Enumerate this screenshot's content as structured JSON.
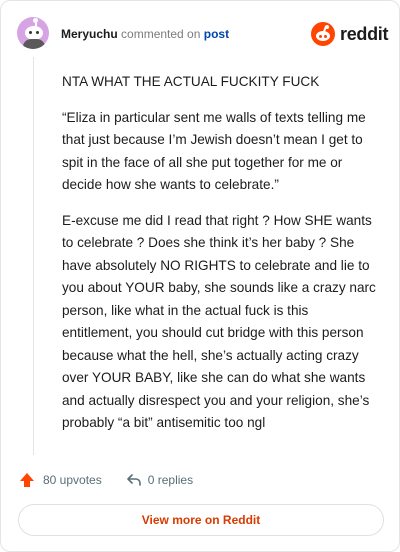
{
  "header": {
    "username": "Meryuchu",
    "action": "commented on",
    "post_link": "post",
    "brand": "reddit"
  },
  "comment": {
    "paragraphs": [
      "NTA WHAT THE ACTUAL FUCKITY FUCK",
      "“Eliza in particular sent me walls of texts telling me that just because I’m Jewish doesn’t mean I get to spit in the face of all she put together for me or decide how she wants to celebrate.”",
      "E-excuse me did I read that right ? How SHE wants to celebrate ? Does she think it’s her baby ? She have absolutely NO RIGHTS to celebrate and lie to you about YOUR baby, she sounds like a crazy narc person, like what in the actual fuck is this entitlement, you should cut bridge with this person because what the hell, she’s actually acting crazy over YOUR BABY, like she can do what she wants and actually disrespect you and your religion, she’s probably “a bit” antisemitic too ngl"
    ]
  },
  "footer": {
    "upvotes": "80 upvotes",
    "replies": "0 replies",
    "view_more": "View more on Reddit"
  },
  "colors": {
    "accent": "#ff4500",
    "link": "#0045ac",
    "view_more_text": "#d93a00"
  },
  "icons": [
    "avatar",
    "reddit-logo-icon",
    "upvote-icon",
    "reply-icon"
  ]
}
